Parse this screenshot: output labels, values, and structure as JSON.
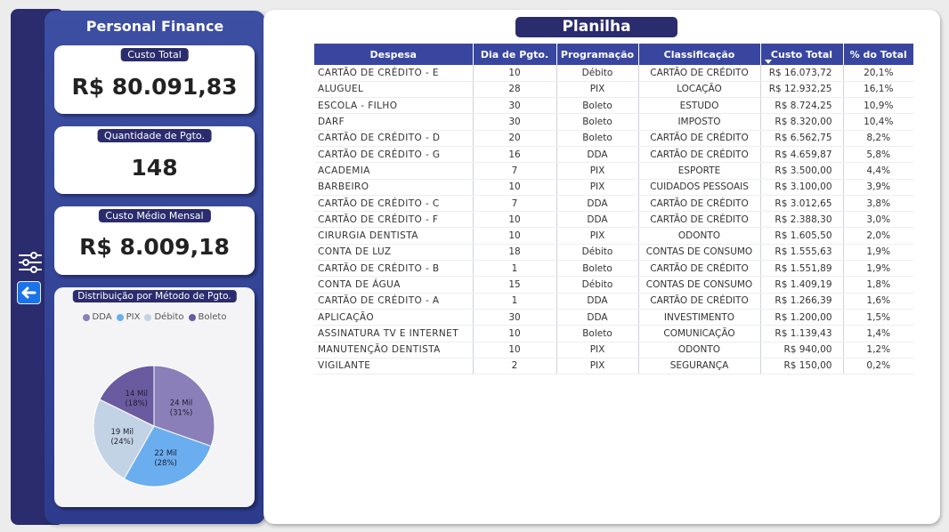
{
  "sidebar": {
    "title": "Personal Finance",
    "cards": [
      {
        "label": "Custo Total",
        "value": "R$ 80.091,83"
      },
      {
        "label": "Quantidade de Pgto.",
        "value": "148"
      },
      {
        "label": "Custo Médio Mensal",
        "value": "R$ 8.009,18"
      }
    ],
    "chart_title": "Distribuição por Método de Pgto."
  },
  "icons": {
    "filter": "sliders-icon",
    "back": "arrow-left-icon"
  },
  "main": {
    "title": "Planilha"
  },
  "table": {
    "headers": [
      "Despesa",
      "Dia de Pgto.",
      "Programação",
      "Classificação",
      "Custo Total",
      "% do Total"
    ],
    "rows": [
      [
        "CARTÃO DE CRÉDITO - E",
        "10",
        "Débito",
        "CARTÃO DE CRÉDITO",
        "R$ 16.073,72",
        "20,1%"
      ],
      [
        "ALUGUEL",
        "28",
        "PIX",
        "LOCAÇÃO",
        "R$ 12.932,25",
        "16,1%"
      ],
      [
        "ESCOLA - FILHO",
        "30",
        "Boleto",
        "ESTUDO",
        "R$ 8.724,25",
        "10,9%"
      ],
      [
        "DARF",
        "30",
        "Boleto",
        "IMPOSTO",
        "R$ 8.320,00",
        "10,4%"
      ],
      [
        "CARTÃO DE CRÉDITO - D",
        "20",
        "Boleto",
        "CARTÃO DE CRÉDITO",
        "R$ 6.562,75",
        "8,2%"
      ],
      [
        "CARTÃO DE CRÉDITO - G",
        "16",
        "DDA",
        "CARTÃO DE CRÉDITO",
        "R$ 4.659,87",
        "5,8%"
      ],
      [
        "ACADEMIA",
        "7",
        "PIX",
        "ESPORTE",
        "R$ 3.500,00",
        "4,4%"
      ],
      [
        "BARBEIRO",
        "10",
        "PIX",
        "CUIDADOS PESSOAIS",
        "R$ 3.100,00",
        "3,9%"
      ],
      [
        "CARTÃO DE CRÉDITO - C",
        "7",
        "DDA",
        "CARTÃO DE CRÉDITO",
        "R$ 3.012,65",
        "3,8%"
      ],
      [
        "CARTÃO DE CRÉDITO - F",
        "10",
        "DDA",
        "CARTÃO DE CRÉDITO",
        "R$ 2.388,30",
        "3,0%"
      ],
      [
        "CIRURGIA DENTISTA",
        "10",
        "PIX",
        "ODONTO",
        "R$ 1.605,50",
        "2,0%"
      ],
      [
        "CONTA DE LUZ",
        "18",
        "Débito",
        "CONTAS DE CONSUMO",
        "R$ 1.555,63",
        "1,9%"
      ],
      [
        "CARTÃO DE CRÉDITO - B",
        "1",
        "Boleto",
        "CARTÃO DE CRÉDITO",
        "R$ 1.551,89",
        "1,9%"
      ],
      [
        "CONTA DE ÁGUA",
        "15",
        "Débito",
        "CONTAS DE CONSUMO",
        "R$ 1.409,19",
        "1,8%"
      ],
      [
        "CARTÃO DE CRÉDITO - A",
        "1",
        "DDA",
        "CARTÃO DE CRÉDITO",
        "R$ 1.266,39",
        "1,6%"
      ],
      [
        "APLICAÇÃO",
        "30",
        "DDA",
        "INVESTIMENTO",
        "R$ 1.200,00",
        "1,5%"
      ],
      [
        "ASSINATURA TV E INTERNET",
        "10",
        "Boleto",
        "COMUNICAÇÃO",
        "R$ 1.139,43",
        "1,4%"
      ],
      [
        "MANUTENÇÃO DENTISTA",
        "10",
        "PIX",
        "ODONTO",
        "R$ 940,00",
        "1,2%"
      ],
      [
        "VIGILANTE",
        "2",
        "PIX",
        "SEGURANÇA",
        "R$ 150,00",
        "0,2%"
      ]
    ]
  },
  "chart_data": {
    "type": "pie",
    "title": "Distribuição por Método de Pgto.",
    "legend_position": "top",
    "categories": [
      "DDA",
      "PIX",
      "Débito",
      "Boleto"
    ],
    "values": [
      24,
      22,
      19,
      14
    ],
    "value_labels": [
      "24 Mil",
      "22 Mil",
      "19 Mil",
      "14 Mil"
    ],
    "percent_labels": [
      "(31%)",
      "(28%)",
      "(24%)",
      "(18%)"
    ],
    "colors": [
      "#8a7fb8",
      "#6aaef0",
      "#c3d3e6",
      "#6a5a9f"
    ]
  }
}
